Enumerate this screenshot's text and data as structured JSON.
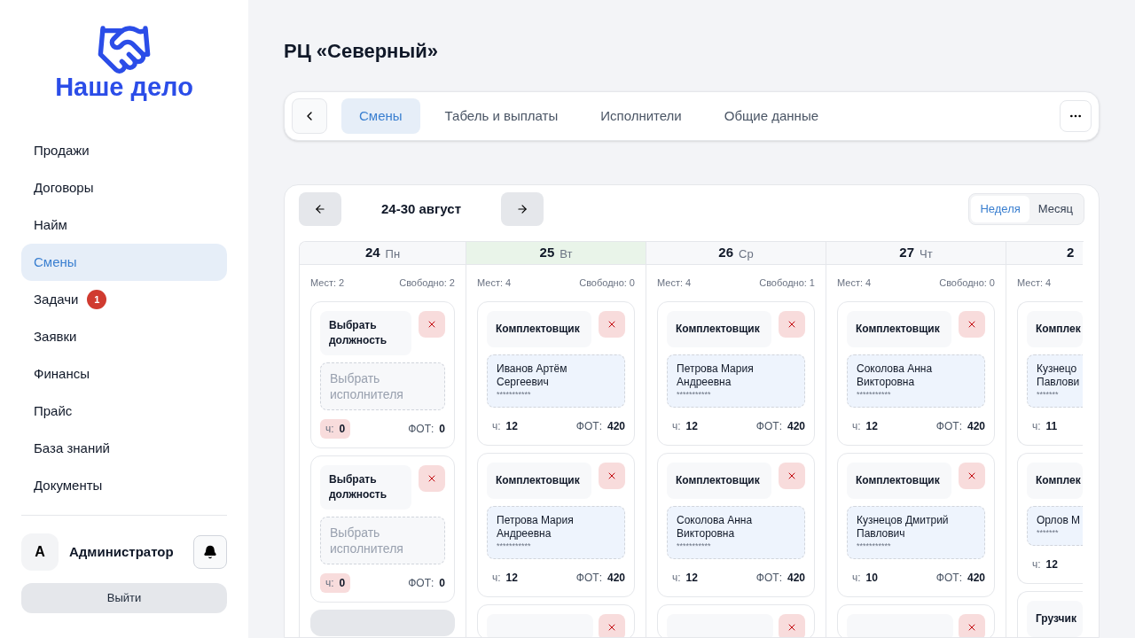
{
  "sidebar": {
    "logo_text": "Наше дело",
    "items": [
      {
        "label": "Продажи",
        "selected": false
      },
      {
        "label": "Договоры",
        "selected": false
      },
      {
        "label": "Найм",
        "selected": false
      },
      {
        "label": "Смены",
        "selected": true
      },
      {
        "label": "Задачи",
        "selected": false,
        "badge": "1"
      },
      {
        "label": "Заявки",
        "selected": false
      },
      {
        "label": "Финансы",
        "selected": false
      },
      {
        "label": "Прайс",
        "selected": false
      },
      {
        "label": "База знаний",
        "selected": false
      },
      {
        "label": "Документы",
        "selected": false
      }
    ],
    "user": {
      "avatar": "А",
      "name": "Администратор"
    },
    "logout": "Выйти"
  },
  "title": "РЦ «Северный»",
  "tabs": [
    {
      "label": "Смены",
      "selected": true
    },
    {
      "label": "Табель и выплаты",
      "selected": false
    },
    {
      "label": "Исполнители",
      "selected": false
    },
    {
      "label": "Общие данные",
      "selected": false
    }
  ],
  "calendar": {
    "range": "24-30 август",
    "views": [
      {
        "label": "Неделя",
        "selected": true
      },
      {
        "label": "Месяц",
        "selected": false
      }
    ],
    "days": [
      {
        "day": "24",
        "weekday": "Пн",
        "today": false,
        "places": "Мест: 2",
        "free": "Свободно: 2",
        "add_button": true,
        "cards": [
          {
            "kind": "empty",
            "role": "Выбрать должность",
            "worker": "Выбрать исполнителя",
            "hours_label": "ч:",
            "hours": "0",
            "hours_warning": true,
            "pay_label": "ФОТ:",
            "pay": "0"
          },
          {
            "kind": "empty",
            "role": "Выбрать должность",
            "worker": "Выбрать исполнителя",
            "hours_label": "ч:",
            "hours": "0",
            "hours_warning": true,
            "pay_label": "ФОТ:",
            "pay": "0"
          }
        ]
      },
      {
        "day": "25",
        "weekday": "Вт",
        "today": true,
        "places": "Мест: 4",
        "free": "Свободно: 0",
        "cards": [
          {
            "kind": "filled",
            "role": "Комплектовщик",
            "worker": "Иванов Артём Сергеевич",
            "phone": "***********",
            "hours_label": "ч:",
            "hours": "12",
            "hours_warning": false,
            "pay_label": "ФОТ:",
            "pay": "420"
          },
          {
            "kind": "filled",
            "role": "Комплектовщик",
            "worker": "Петрова Мария Андреевна",
            "phone": "***********",
            "hours_label": "ч:",
            "hours": "12",
            "hours_warning": false,
            "pay_label": "ФОТ:",
            "pay": "420"
          },
          {
            "kind": "cut"
          }
        ]
      },
      {
        "day": "26",
        "weekday": "Ср",
        "today": false,
        "places": "Мест: 4",
        "free": "Свободно: 1",
        "cards": [
          {
            "kind": "filled",
            "role": "Комплектовщик",
            "worker": "Петрова Мария Андреевна",
            "phone": "***********",
            "hours_label": "ч:",
            "hours": "12",
            "hours_warning": false,
            "pay_label": "ФОТ:",
            "pay": "420"
          },
          {
            "kind": "filled",
            "role": "Комплектовщик",
            "worker": "Соколова Анна Викторовна",
            "phone": "***********",
            "hours_label": "ч:",
            "hours": "12",
            "hours_warning": false,
            "pay_label": "ФОТ:",
            "pay": "420"
          },
          {
            "kind": "cut"
          }
        ]
      },
      {
        "day": "27",
        "weekday": "Чт",
        "today": false,
        "places": "Мест: 4",
        "free": "Свободно: 0",
        "cards": [
          {
            "kind": "filled",
            "role": "Комплектовщик",
            "worker": "Соколова Анна Викторовна",
            "phone": "***********",
            "hours_label": "ч:",
            "hours": "12",
            "hours_warning": false,
            "pay_label": "ФОТ:",
            "pay": "420"
          },
          {
            "kind": "filled",
            "role": "Комплектовщик",
            "worker": "Кузнецов Дмитрий Павлович",
            "phone": "***********",
            "hours_label": "ч:",
            "hours": "10",
            "hours_warning": false,
            "pay_label": "ФОТ:",
            "pay": "420"
          },
          {
            "kind": "cut"
          }
        ]
      },
      {
        "day": "2",
        "today": false,
        "partial": true,
        "places": "Мест: 4",
        "cards": [
          {
            "kind": "partial",
            "role": "Комплек",
            "worker": "Кузнецо Павлови",
            "phone": "*******",
            "hours_label": "ч:",
            "hours": "11"
          },
          {
            "kind": "partial",
            "role": "Комплек",
            "worker": "Орлов М",
            "phone": "*******",
            "hours_label": "ч:",
            "hours": "12"
          },
          {
            "kind": "partial",
            "role": "Грузчик"
          }
        ]
      }
    ]
  }
}
